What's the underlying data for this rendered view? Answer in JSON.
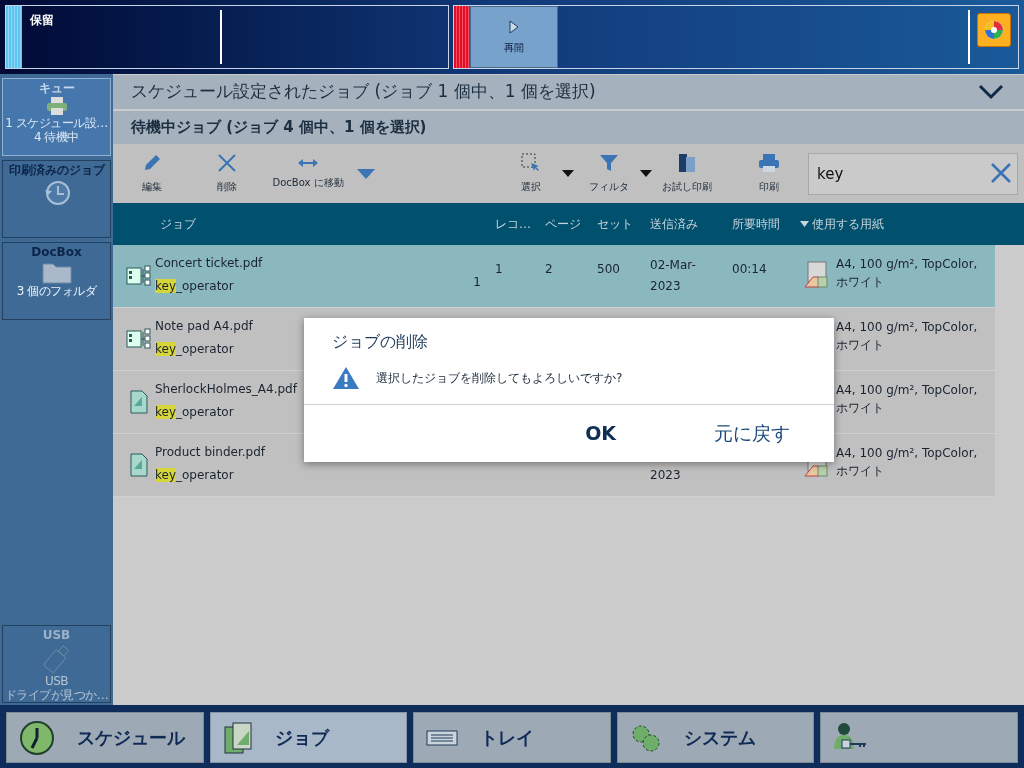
{
  "top_bar": {
    "status_label": "保留",
    "resume_button": "再開"
  },
  "sidebar": {
    "items": [
      {
        "title": "キュー",
        "lines": [
          "1 スケジュール設…",
          "4 待機中"
        ],
        "selected": true,
        "disabled": false
      },
      {
        "title": "印刷済みのジョブ",
        "selected": false,
        "disabled": false
      },
      {
        "title": "DocBox",
        "lines": [
          "3 個のフォルダ"
        ],
        "selected": false,
        "disabled": false
      },
      {
        "title": "USB",
        "lines": [
          "USB",
          "ドライブが見つか…"
        ],
        "selected": false,
        "disabled": true
      }
    ]
  },
  "scheduled_header": "スケジュール設定されたジョブ (ジョブ 1 個中、1 個を選択)",
  "waiting_header": "待機中ジョブ (ジョブ 4 個中、1 個を選択)",
  "toolbar": {
    "buttons": [
      {
        "label": "編集",
        "has_menu": false
      },
      {
        "label": "削除",
        "has_menu": false
      },
      {
        "label": "DocBox に移動",
        "has_menu": true
      },
      {
        "label": "選択",
        "has_menu": true
      },
      {
        "label": "フィルタ",
        "has_menu": true
      },
      {
        "label": "お試し印刷",
        "has_menu": false
      },
      {
        "label": "印刷",
        "has_menu": false
      }
    ],
    "search": {
      "value": "key"
    }
  },
  "table": {
    "columns": [
      {
        "label": "ジョブ",
        "sorted": false
      },
      {
        "label": "レコ…",
        "sorted": false
      },
      {
        "label": "ページ",
        "sorted": false
      },
      {
        "label": "セット",
        "sorted": false
      },
      {
        "label": "送信済み",
        "sorted": false
      },
      {
        "label": "所要時間",
        "sorted": false
      },
      {
        "label": "使用する用紙",
        "sorted": true
      }
    ],
    "rows": [
      {
        "kind": "workflow",
        "name": "Concert ticket.pdf",
        "owner_match": "key",
        "owner_rest": "_operator",
        "job_column_line_2": "1",
        "records": "1",
        "pages": "2",
        "sets": "500",
        "sent": [
          "02-Mar-",
          "2023"
        ],
        "time": "00:14",
        "paper_icon": true,
        "paper": "A4, 100 g/m², TopColor, ホワイト",
        "selected": true
      },
      {
        "kind": "workflow",
        "name": "Note pad A4.pdf",
        "owner_match": "key",
        "owner_rest": "_operator",
        "paper_icon": false,
        "paper": "A4, 100 g/m², TopColor, ホワイト",
        "selected": false
      },
      {
        "kind": "document",
        "name": "SherlockHolmes_A4.pdf",
        "owner_match": "key",
        "owner_rest": "_operator",
        "paper_icon": false,
        "paper": "A4, 100 g/m², TopColor, ホワイト",
        "selected": false
      },
      {
        "kind": "document",
        "name": "Product binder.pdf",
        "owner_match": "key",
        "owner_rest": "_operator",
        "sent_line_2": "2023",
        "paper_icon": true,
        "paper": "A4, 100 g/m², TopColor, ホワイト",
        "selected": false
      }
    ]
  },
  "dialog": {
    "title": "ジョブの削除",
    "message": "選択したジョブを削除してもよろしいですか?",
    "buttons": [
      "OK",
      "元に戻す"
    ]
  },
  "bottom_nav": [
    {
      "label": "スケジュール",
      "selected": false
    },
    {
      "label": "ジョブ",
      "selected": true
    },
    {
      "label": "トレイ",
      "selected": false
    },
    {
      "label": "システム",
      "selected": false
    },
    {
      "selected": false
    }
  ]
}
